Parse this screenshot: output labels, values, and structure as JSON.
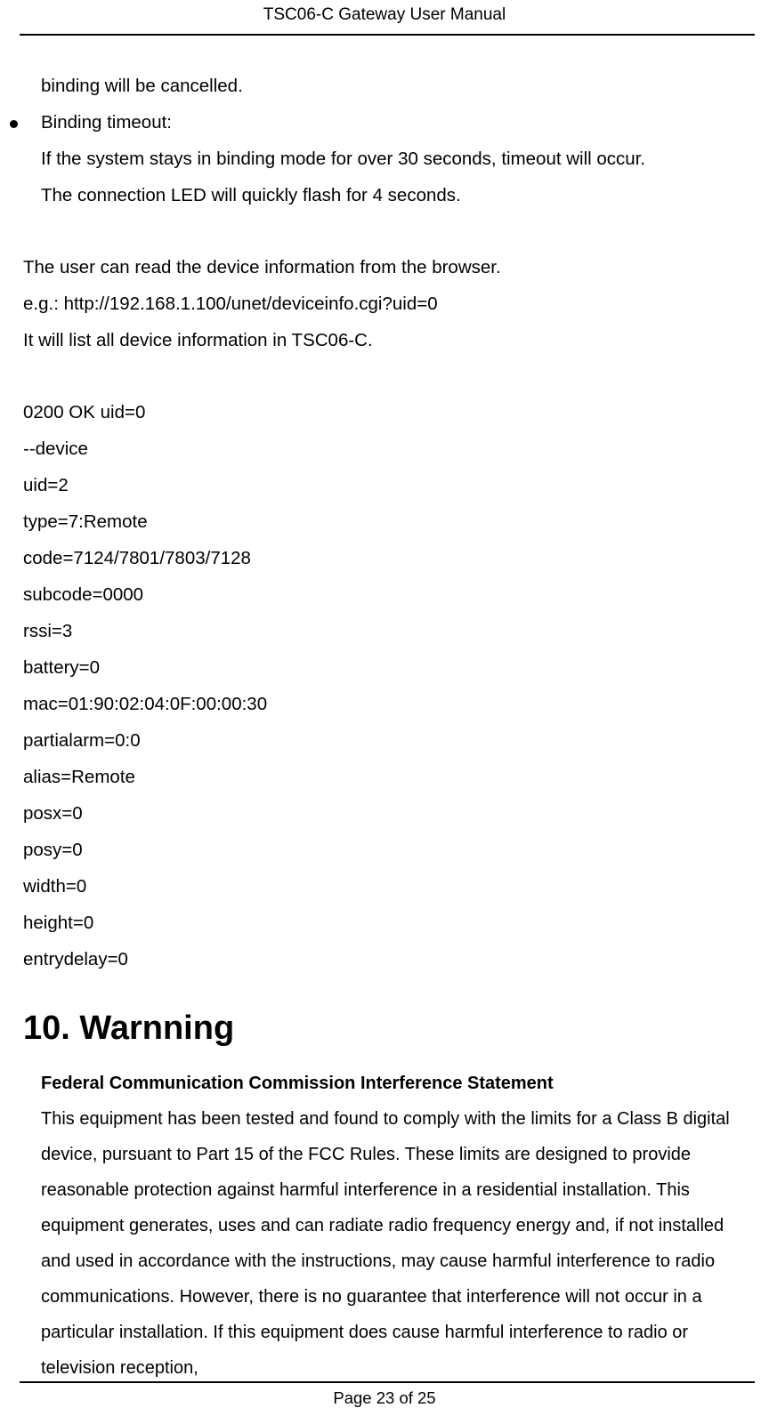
{
  "header": {
    "title": "TSC06-C Gateway User Manual"
  },
  "intro": {
    "line1": "binding will be cancelled.",
    "bullet_label": "Binding timeout:",
    "bullet_desc1": "If the system stays in binding mode for over 30 seconds, timeout will occur.",
    "bullet_desc2": "The connection LED will quickly flash for 4 seconds."
  },
  "browser_info": {
    "line1": "The user can read the device information from the browser.",
    "line2": "e.g.: http://192.168.1.100/unet/deviceinfo.cgi?uid=0",
    "line3": "It will list all device information in TSC06-C."
  },
  "device_output": {
    "l0": "0200 OK uid=0",
    "l1": "--device",
    "l2": "uid=2",
    "l3": "type=7:Remote",
    "l4": "code=7124/7801/7803/7128",
    "l5": "subcode=0000",
    "l6": "rssi=3",
    "l7": "battery=0",
    "l8": "mac=01:90:02:04:0F:00:00:30",
    "l9": "partialarm=0:0",
    "l10": "alias=Remote",
    "l11": "posx=0",
    "l12": "posy=0",
    "l13": "width=0",
    "l14": "height=0",
    "l15": "entrydelay=0"
  },
  "section": {
    "heading": "10. Warnning"
  },
  "warning": {
    "title": "Federal Communication Commission Interference Statement",
    "body": "This equipment has been tested and found to comply with the limits for a Class B digital device, pursuant to Part 15 of the FCC Rules. These limits are designed to provide reasonable protection against harmful interference in a residential installation. This equipment generates, uses and can radiate radio frequency energy and, if not installed and used in accordance with the instructions, may cause harmful interference to radio communications. However, there is no guarantee that interference will not occur in a particular installation. If this equipment does cause harmful interference to radio or television reception,"
  },
  "footer": {
    "text": "Page 23 of 25"
  }
}
